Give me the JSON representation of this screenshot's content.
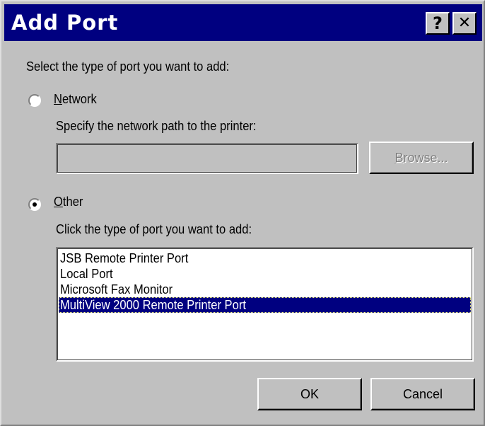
{
  "window": {
    "title": "Add Port",
    "help_label": "?",
    "close_label": "✕",
    "title_bg": "#000080",
    "face_color": "#c0c0c0"
  },
  "prompt": "Select the type of port you want to add:",
  "network": {
    "radio_label": "Network",
    "selected": false,
    "path_label": "Specify the network path to the printer:",
    "path_value": "",
    "browse_label": "Browse...",
    "browse_enabled": false
  },
  "other": {
    "radio_label": "Other",
    "selected": true,
    "list_label": "Click the type of port you want to add:",
    "port_types": [
      "JSB Remote Printer Port",
      "Local Port",
      "Microsoft Fax Monitor",
      "MultiView 2000 Remote Printer Port"
    ],
    "selected_port": "MultiView 2000 Remote Printer Port"
  },
  "buttons": {
    "ok": "OK",
    "cancel": "Cancel"
  }
}
